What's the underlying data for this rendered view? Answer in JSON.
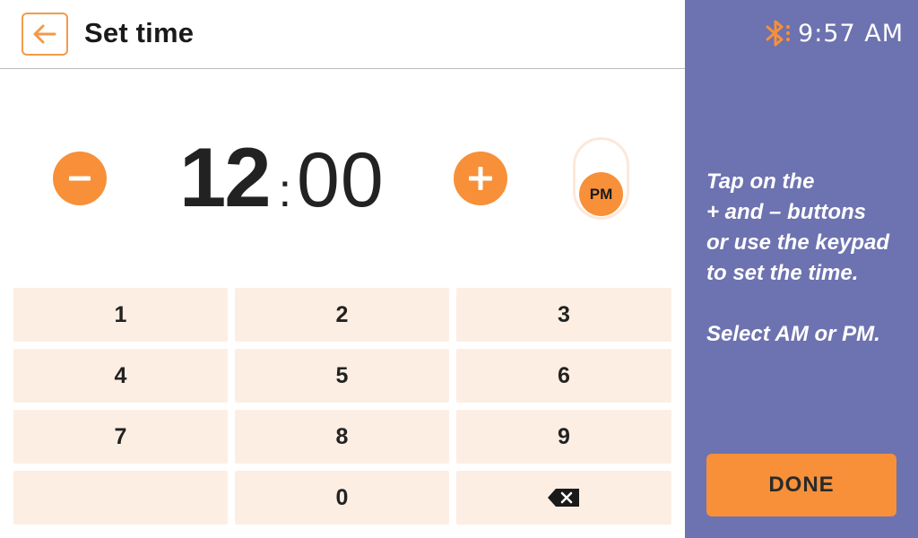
{
  "header": {
    "title": "Set time",
    "back_icon": "arrow-left-icon"
  },
  "time": {
    "hours": "12",
    "separator": ":",
    "minutes": "00",
    "period": "PM"
  },
  "controls": {
    "decrement_icon": "minus-icon",
    "increment_icon": "plus-icon"
  },
  "keypad": {
    "keys": [
      "1",
      "2",
      "3",
      "4",
      "5",
      "6",
      "7",
      "8",
      "9",
      "",
      "0"
    ],
    "backspace_icon": "backspace-icon"
  },
  "status_bar": {
    "bluetooth_icon": "bluetooth-icon",
    "time": "9:57 AM"
  },
  "instructions": {
    "line1": "Tap on the\n+ and – buttons\nor use the keypad\nto set the time.",
    "line2": "Select AM or PM."
  },
  "done_label": "DONE",
  "colors": {
    "accent": "#f79039",
    "panel": "#6d72b0",
    "key_bg": "#fdeee3"
  }
}
